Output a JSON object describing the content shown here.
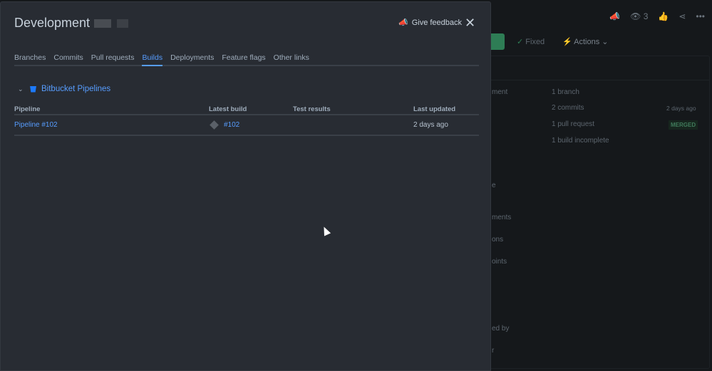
{
  "background": {
    "watch_count": "3",
    "fixed_label": "Fixed",
    "actions_label": "Actions",
    "summary": [
      {
        "text": "1 branch",
        "meta": ""
      },
      {
        "text": "2 commits",
        "meta": "2 days ago"
      },
      {
        "text": "1 pull request",
        "meta": "MERGED"
      },
      {
        "text": "1 build incomplete",
        "meta": ""
      }
    ],
    "left_fragments": [
      "ment",
      "e",
      "ments",
      "ons",
      "oints",
      "ed by",
      "r"
    ]
  },
  "modal": {
    "title": "Development",
    "feedback_label": "Give feedback",
    "tabs": [
      {
        "label": "Branches"
      },
      {
        "label": "Commits"
      },
      {
        "label": "Pull requests"
      },
      {
        "label": "Builds",
        "active": true
      },
      {
        "label": "Deployments"
      },
      {
        "label": "Feature flags"
      },
      {
        "label": "Other links"
      }
    ],
    "section_title": "Bitbucket Pipelines",
    "columns": [
      "Pipeline",
      "Latest build",
      "Test results",
      "Last updated"
    ],
    "rows": [
      {
        "pipeline": "Pipeline #102",
        "latest_build": "#102",
        "test_results": "",
        "last_updated": "2 days ago"
      }
    ]
  },
  "colors": {
    "accent": "#579dff",
    "modal_bg": "#282c33",
    "merged": "#3f7a5a"
  }
}
